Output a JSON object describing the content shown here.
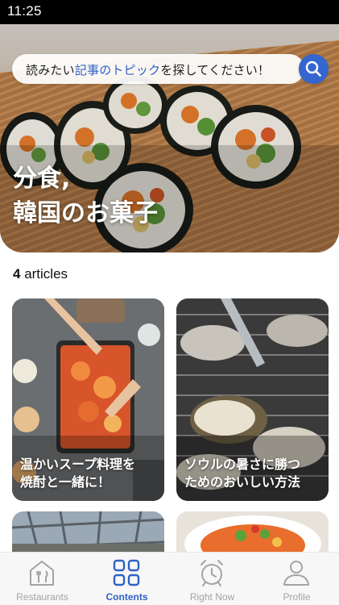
{
  "status_bar": {
    "time": "11:25"
  },
  "search": {
    "text_before": "読みたい",
    "text_highlight": "記事のトピック",
    "text_after": "を探してください！",
    "icon": "search-icon"
  },
  "hero": {
    "title_line1": "分食,",
    "title_line2": "韓国のお菓子"
  },
  "articles": {
    "count": "4",
    "count_suffix": " articles",
    "items": [
      {
        "line1": "温かいスープ料理を",
        "line2": "焼酎と一緒に！"
      },
      {
        "line1": "ソウルの暑さに勝つ",
        "line2": "ためのおいしい方法"
      },
      {
        "line1": "",
        "line2": ""
      },
      {
        "line1": "",
        "line2": ""
      }
    ]
  },
  "nav": {
    "items": [
      {
        "label": "Restaurants",
        "icon": "restaurant-icon",
        "active": false
      },
      {
        "label": "Contents",
        "icon": "grid-icon",
        "active": true
      },
      {
        "label": "Right Now",
        "icon": "alarm-clock-icon",
        "active": false
      },
      {
        "label": "Profile",
        "icon": "person-icon",
        "active": false
      }
    ]
  },
  "colors": {
    "accent": "#3566cf",
    "inactive": "#a3a3a3",
    "status_bar": "#000000"
  }
}
